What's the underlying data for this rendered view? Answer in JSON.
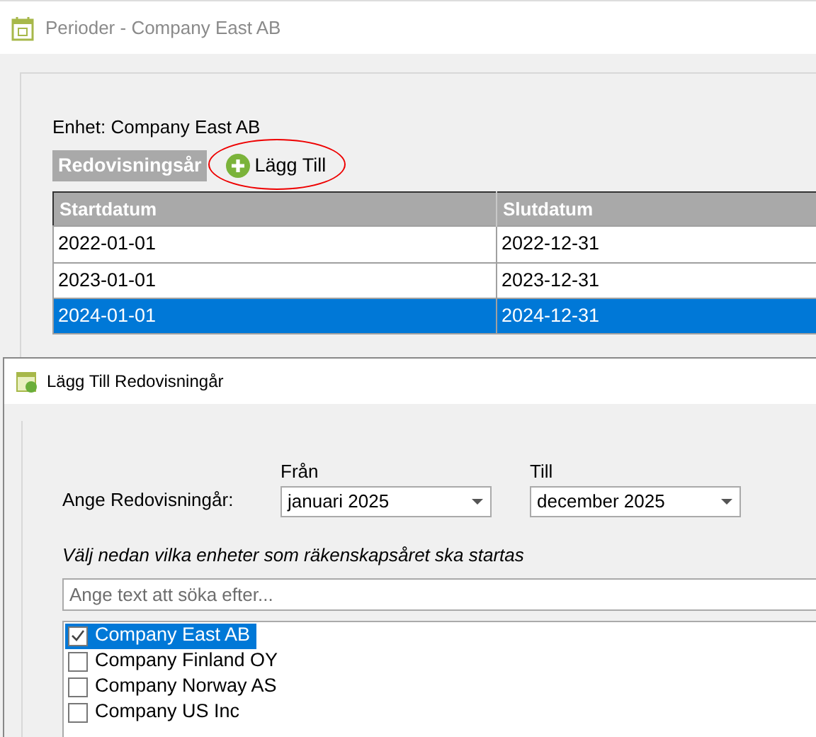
{
  "window": {
    "title": "Perioder - Company East AB"
  },
  "entity_label": "Enhet: Company East AB",
  "section_label": "Redovisningsår",
  "add_button": {
    "label": "Lägg Till",
    "highlighted": true
  },
  "table": {
    "columns": [
      "Startdatum",
      "Slutdatum"
    ],
    "rows": [
      {
        "cells": [
          "2022-01-01",
          "2022-12-31"
        ],
        "selected": false
      },
      {
        "cells": [
          "2023-01-01",
          "2023-12-31"
        ],
        "selected": false
      },
      {
        "cells": [
          "2024-01-01",
          "2024-12-31"
        ],
        "selected": true
      }
    ]
  },
  "dialog": {
    "title": "Lägg Till Redovisningår",
    "period_label": "Ange Redovisningår:",
    "from": {
      "label": "Från",
      "value": "januari 2025"
    },
    "to": {
      "label": "Till",
      "value": "december 2025"
    },
    "instruction": "Välj nedan vilka enheter som räkenskapsåret ska startas",
    "search": {
      "placeholder": "Ange text att söka efter..."
    },
    "entities": [
      {
        "name": "Company East AB",
        "checked": true,
        "selected": true
      },
      {
        "name": "Company Finland OY",
        "checked": false,
        "selected": false
      },
      {
        "name": "Company Norway AS",
        "checked": false,
        "selected": false
      },
      {
        "name": "Company US Inc",
        "checked": false,
        "selected": false
      }
    ]
  }
}
